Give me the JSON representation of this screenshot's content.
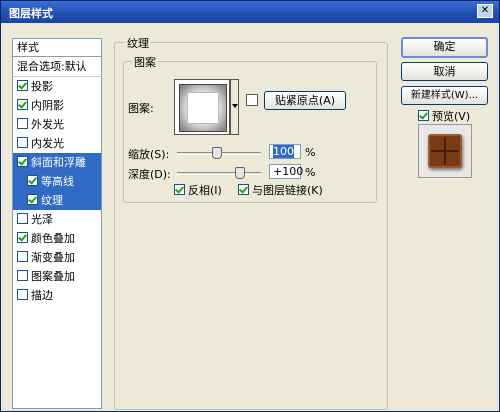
{
  "title": "图层样式",
  "close_glyph": "✕",
  "styles_panel": {
    "header": "样式",
    "blend_options": "混合选项:默认",
    "items": [
      {
        "label": "投影",
        "checked": true
      },
      {
        "label": "内阴影",
        "checked": true
      },
      {
        "label": "外发光",
        "checked": false
      },
      {
        "label": "内发光",
        "checked": false
      },
      {
        "label": "斜面和浮雕",
        "checked": true
      },
      {
        "label": "等高线",
        "checked": true
      },
      {
        "label": "纹理",
        "checked": true
      },
      {
        "label": "光泽",
        "checked": false
      },
      {
        "label": "颜色叠加",
        "checked": true
      },
      {
        "label": "渐变叠加",
        "checked": false
      },
      {
        "label": "图案叠加",
        "checked": false
      },
      {
        "label": "描边",
        "checked": false
      }
    ]
  },
  "texture": {
    "group_title": "纹理",
    "pattern_group": "图案",
    "pattern_label": "图案:",
    "snap_button": "贴紧原点(A)",
    "scale_label": "缩放(S):",
    "scale_value": "100",
    "scale_unit": "%",
    "depth_label": "深度(D):",
    "depth_value": "+100",
    "depth_unit": "%",
    "invert_label": "反相(I)",
    "invert_checked": true,
    "link_label": "与图层链接(K)",
    "link_checked": true
  },
  "buttons": {
    "ok": "确定",
    "cancel": "取消",
    "new_style": "新建样式(W)..."
  },
  "preview": {
    "label": "预览(V)",
    "checked": true
  },
  "colors": {
    "accent": "#316ac5",
    "title_bar": "#1f4fb3",
    "chocolate": "#7a3a14"
  }
}
